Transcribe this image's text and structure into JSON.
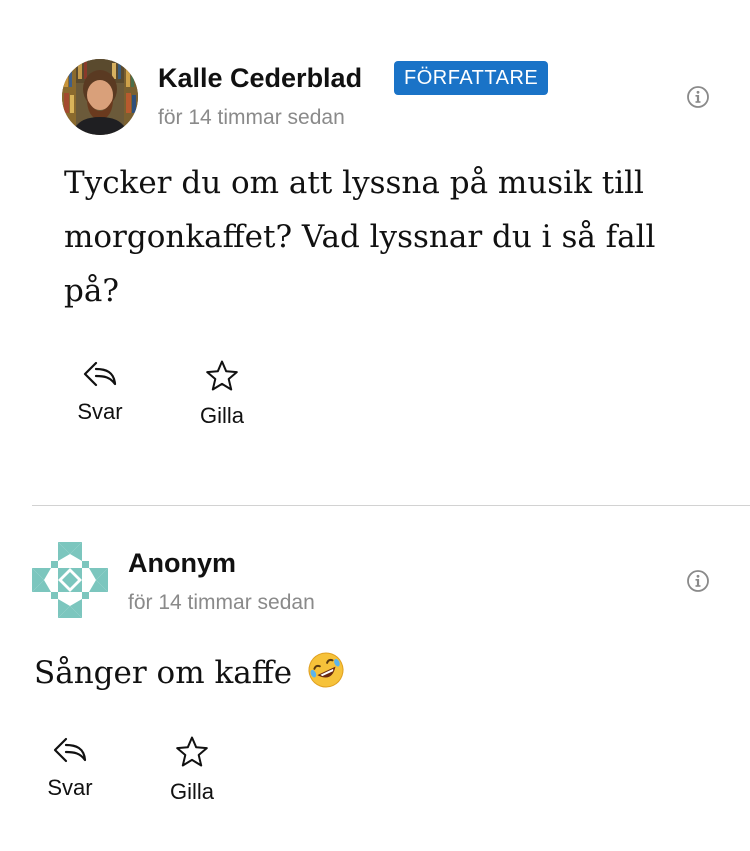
{
  "comments": [
    {
      "author": "Kalle Cederblad",
      "badge": "FÖRFATTARE",
      "timestamp": "för 14 timmar sedan",
      "body": "Tycker du om att lyssna på musik till morgonkaffet? Vad lyssnar du i så fall på?",
      "actions": {
        "reply": "Svar",
        "like": "Gilla"
      }
    },
    {
      "author": "Anonym",
      "timestamp": "för 14 timmar sedan",
      "body": "Sånger om kaffe",
      "emoji": "rolling-on-floor-laughing-emoji",
      "actions": {
        "reply": "Svar",
        "like": "Gilla"
      }
    }
  ],
  "colors": {
    "badge_background": "#1a73c7",
    "timestamp": "#8a8a8a",
    "divider": "#d2d2d2",
    "identicon": "#7cc6be"
  },
  "icons": {
    "info": "info-icon",
    "reply": "reply-arrow-icon",
    "like": "star-icon"
  }
}
